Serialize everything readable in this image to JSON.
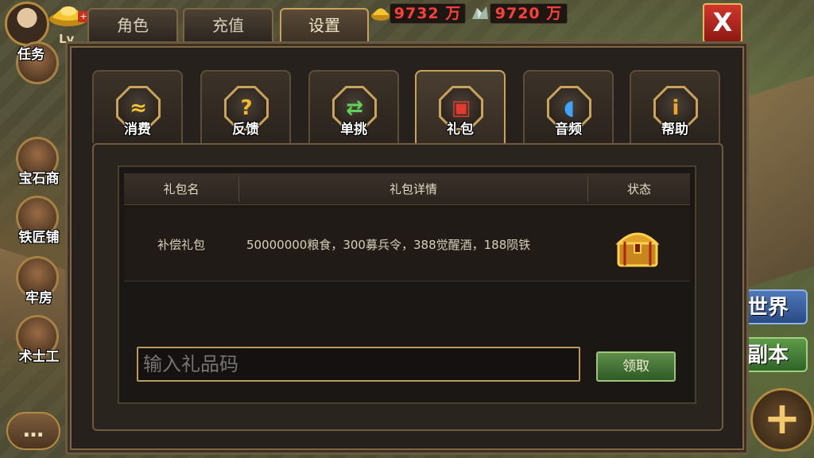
{
  "header": {
    "level_prefix": "Lv",
    "top_tabs": [
      {
        "label": "角色",
        "active": false
      },
      {
        "label": "充值",
        "active": false
      },
      {
        "label": "设置",
        "active": true
      }
    ],
    "resources": [
      {
        "icon": "gold-ingot-icon",
        "value": "9732 万"
      },
      {
        "icon": "ore-icon",
        "value": "9720 万"
      }
    ],
    "close_label": "X"
  },
  "side": {
    "buttons": [
      {
        "name": "quest",
        "label": "任务"
      },
      {
        "name": "gem-shop",
        "label": "宝石商"
      },
      {
        "name": "blacksmith",
        "label": "铁匠铺"
      },
      {
        "name": "prison",
        "label": "牢房"
      },
      {
        "name": "wizard",
        "label": "术士工"
      }
    ],
    "right_buttons": [
      {
        "name": "world",
        "label": "世界"
      },
      {
        "name": "dungeon",
        "label": "副本"
      }
    ],
    "chat_label": "…",
    "plus_label": "+"
  },
  "panel": {
    "categories": [
      {
        "label": "消费",
        "icon": "gold-ingot-icon",
        "glyph": "≈",
        "active": false
      },
      {
        "label": "反馈",
        "icon": "question-icon",
        "glyph": "?",
        "active": false
      },
      {
        "label": "单挑",
        "icon": "shuffle-icon",
        "glyph": "⇄",
        "active": false
      },
      {
        "label": "礼包",
        "icon": "gift-icon",
        "glyph": "▣",
        "active": true
      },
      {
        "label": "音频",
        "icon": "sound-icon",
        "glyph": "◖",
        "active": false
      },
      {
        "label": "帮助",
        "icon": "info-icon",
        "glyph": "i",
        "active": false
      }
    ],
    "table": {
      "headers": [
        "礼包名",
        "礼包详情",
        "状态"
      ],
      "rows": [
        {
          "name": "补偿礼包",
          "detail": "50000000粮食，300募兵令，388觉醒酒，188陨铁",
          "status_icon": "treasure-chest-icon"
        }
      ]
    },
    "gift_code": {
      "placeholder": "输入礼品码",
      "value": ""
    },
    "claim_label": "领取"
  },
  "colors": {
    "accent_gold": "#c9a35a",
    "resource_red": "#ff4036",
    "claim_green": "#4d7a3c",
    "close_red": "#c0302a"
  }
}
